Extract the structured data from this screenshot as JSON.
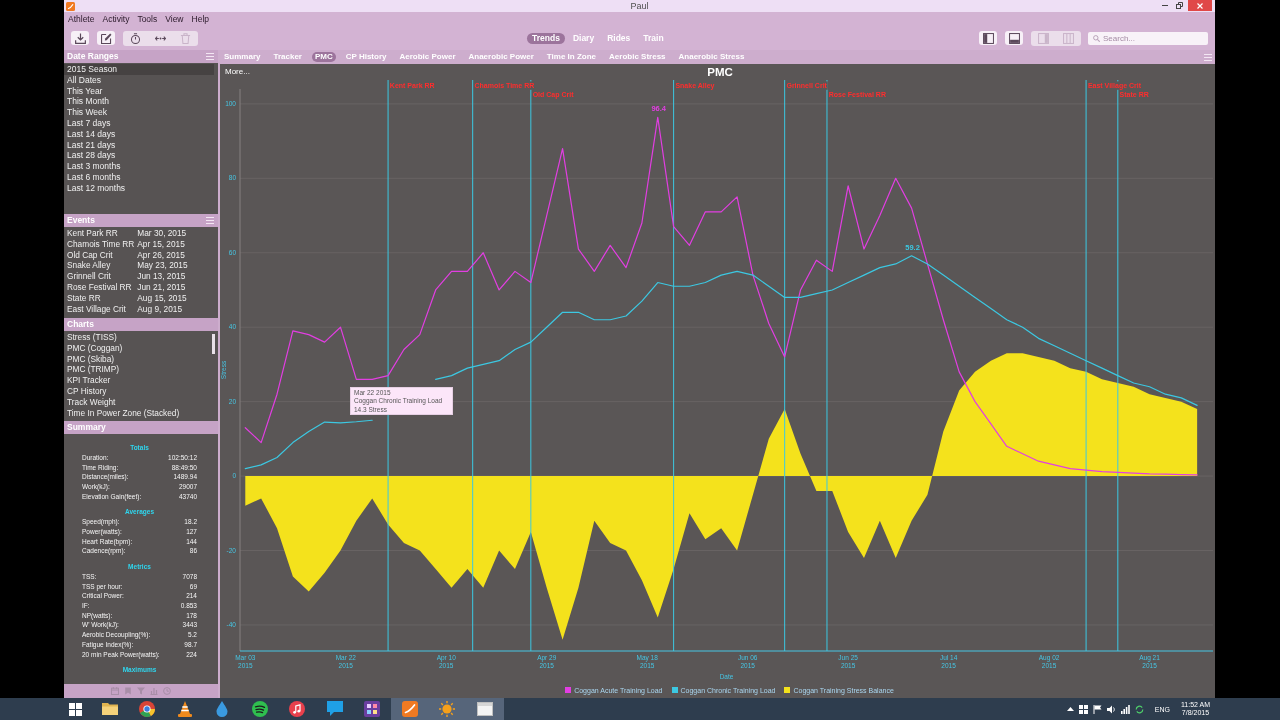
{
  "window": {
    "title": "Paul"
  },
  "menu": [
    "Athlete",
    "Activity",
    "Tools",
    "View",
    "Help"
  ],
  "toolbar": {
    "left_groups": [
      [
        {
          "kind": "download",
          "disabled": false
        }
      ],
      [
        {
          "kind": "edit",
          "disabled": false
        }
      ],
      [
        {
          "kind": "stopwatch",
          "disabled": false
        },
        {
          "kind": "arrows",
          "disabled": false
        },
        {
          "kind": "trash",
          "disabled": true
        }
      ]
    ],
    "views": [
      {
        "label": "Trends",
        "selected": true
      },
      {
        "label": "Diary",
        "selected": false
      },
      {
        "label": "Rides",
        "selected": false
      },
      {
        "label": "Train",
        "selected": false
      }
    ],
    "right_groups": [
      [
        {
          "kind": "leftpanel",
          "disabled": false
        }
      ],
      [
        {
          "kind": "bottompanel",
          "disabled": false
        }
      ],
      [
        {
          "kind": "rightpanel",
          "disabled": true
        },
        {
          "kind": "columns",
          "disabled": true
        }
      ]
    ],
    "search": {
      "placeholder": "Search..."
    }
  },
  "tabs": [
    {
      "label": "Summary",
      "selected": false
    },
    {
      "label": "Tracker",
      "selected": false
    },
    {
      "label": "PMC",
      "selected": true
    },
    {
      "label": "CP History",
      "selected": false
    },
    {
      "label": "Aerobic Power",
      "selected": false
    },
    {
      "label": "Anaerobic Power",
      "selected": false
    },
    {
      "label": "Time In Zone",
      "selected": false
    },
    {
      "label": "Aerobic Stress",
      "selected": false
    },
    {
      "label": "Anaerobic Stress",
      "selected": false
    }
  ],
  "sidebar": {
    "date_ranges": {
      "title": "Date Ranges",
      "items": [
        {
          "label": "2015 Season",
          "selected": true
        },
        {
          "label": "All Dates",
          "selected": false
        },
        {
          "label": "This Year",
          "selected": false
        },
        {
          "label": "This Month",
          "selected": false
        },
        {
          "label": "This Week",
          "selected": false
        },
        {
          "label": "Last 7 days",
          "selected": false
        },
        {
          "label": "Last 14 days",
          "selected": false
        },
        {
          "label": "Last 21 days",
          "selected": false
        },
        {
          "label": "Last 28 days",
          "selected": false
        },
        {
          "label": "Last 3 months",
          "selected": false
        },
        {
          "label": "Last 6 months",
          "selected": false
        },
        {
          "label": "Last 12 months",
          "selected": false
        }
      ]
    },
    "events": {
      "title": "Events",
      "items": [
        {
          "name": "Kent Park RR",
          "date": "Mar 30, 2015"
        },
        {
          "name": "Chamois Time RR",
          "date": "Apr 15, 2015"
        },
        {
          "name": "Old Cap Crit",
          "date": "Apr 26, 2015"
        },
        {
          "name": "Snake Alley",
          "date": "May 23, 2015"
        },
        {
          "name": "Grinnell Crit",
          "date": "Jun 13, 2015"
        },
        {
          "name": "Rose Festival RR",
          "date": "Jun 21, 2015"
        },
        {
          "name": "State RR",
          "date": "Aug 15, 2015"
        },
        {
          "name": "East Village Crit",
          "date": "Aug 9, 2015"
        }
      ]
    },
    "charts": {
      "title": "Charts",
      "items": [
        "Stress (TISS)",
        "PMC (Coggan)",
        "PMC (Skiba)",
        "PMC (TRIMP)",
        "KPI Tracker",
        "CP History",
        "Track Weight",
        "Time In Power Zone (Stacked)"
      ]
    },
    "summary": {
      "title": "Summary",
      "sections": [
        {
          "heading": "Totals",
          "rows": [
            {
              "label": "Duration:",
              "value": "102:50:12"
            },
            {
              "label": "Time Riding:",
              "value": "88:49:50"
            },
            {
              "label": "Distance(miles):",
              "value": "1489.94"
            },
            {
              "label": "Work(kJ):",
              "value": "29007"
            },
            {
              "label": "Elevation Gain(feet):",
              "value": "43740"
            }
          ]
        },
        {
          "heading": "Averages",
          "rows": [
            {
              "label": "Speed(mph):",
              "value": "18.2"
            },
            {
              "label": "Power(watts):",
              "value": "127"
            },
            {
              "label": "Heart Rate(bpm):",
              "value": "144"
            },
            {
              "label": "Cadence(rpm):",
              "value": "86"
            }
          ]
        },
        {
          "heading": "Metrics",
          "rows": [
            {
              "label": "TSS:",
              "value": "7078"
            },
            {
              "label": "TSS per hour:",
              "value": "69"
            },
            {
              "label": "Critical Power:",
              "value": "214"
            },
            {
              "label": "IF:",
              "value": "0.853"
            },
            {
              "label": "NP(watts):",
              "value": "178"
            },
            {
              "label": "W' Work(kJ):",
              "value": "3443"
            },
            {
              "label": "Aerobic Decoupling(%):",
              "value": "5.2"
            },
            {
              "label": "Fatigue Index(%):",
              "value": "98.7"
            },
            {
              "label": "20 min Peak Power(watts):",
              "value": "224"
            }
          ]
        },
        {
          "heading": "Maximums"
        }
      ]
    }
  },
  "pmc": {
    "more_link": "More...",
    "tooltip": [
      "Mar 22 2015",
      "Coggan Chronic Training Load",
      "14.3 Stress"
    ],
    "chart_data": {
      "type": "line",
      "title": "PMC",
      "xlabel": "Date",
      "ylabel": "Stress",
      "x": [
        "2015-03-03",
        "2015-03-06",
        "2015-03-09",
        "2015-03-12",
        "2015-03-15",
        "2015-03-18",
        "2015-03-21",
        "2015-03-24",
        "2015-03-27",
        "2015-03-30",
        "2015-04-02",
        "2015-04-05",
        "2015-04-08",
        "2015-04-11",
        "2015-04-14",
        "2015-04-17",
        "2015-04-20",
        "2015-04-23",
        "2015-04-26",
        "2015-04-29",
        "2015-05-02",
        "2015-05-05",
        "2015-05-08",
        "2015-05-11",
        "2015-05-14",
        "2015-05-17",
        "2015-05-20",
        "2015-05-23",
        "2015-05-26",
        "2015-05-29",
        "2015-06-01",
        "2015-06-04",
        "2015-06-07",
        "2015-06-10",
        "2015-06-13",
        "2015-06-16",
        "2015-06-19",
        "2015-06-22",
        "2015-06-25",
        "2015-06-28",
        "2015-07-01",
        "2015-07-04",
        "2015-07-07",
        "2015-07-10",
        "2015-07-13",
        "2015-07-16",
        "2015-07-19",
        "2015-07-22",
        "2015-07-25",
        "2015-07-28",
        "2015-07-31",
        "2015-08-03",
        "2015-08-06",
        "2015-08-09",
        "2015-08-12",
        "2015-08-15",
        "2015-08-18",
        "2015-08-21",
        "2015-08-24",
        "2015-08-27",
        "2015-08-30"
      ],
      "series": [
        {
          "name": "Coggan Acute Training Load",
          "color": "#e23ee2",
          "values": [
            13,
            9,
            22,
            39,
            38,
            36,
            40,
            26,
            26,
            27,
            34,
            38,
            50,
            55,
            55,
            60,
            50,
            55,
            52,
            70,
            88,
            61,
            55,
            62,
            56,
            68,
            96.4,
            67,
            62,
            71,
            71,
            75,
            54,
            41,
            32,
            50,
            58,
            55,
            78,
            61,
            70,
            80,
            72,
            57,
            42,
            28,
            20,
            14,
            8,
            6,
            4,
            3,
            2,
            1.6,
            1.2,
            1,
            0.8,
            0.6,
            0.5,
            0.4,
            0.3
          ]
        },
        {
          "name": "Coggan Chronic Training Load",
          "color": "#3cc8e2",
          "values": [
            2,
            3,
            5,
            9,
            12,
            14.5,
            14.3,
            14.6,
            15,
            null,
            null,
            null,
            26,
            27,
            29,
            30,
            31,
            34,
            36,
            40,
            44,
            44,
            42,
            42,
            43,
            47,
            52,
            51,
            51,
            52,
            54,
            55,
            54,
            51,
            48,
            48,
            49,
            50,
            52,
            54,
            56,
            57,
            59.2,
            57,
            54,
            51,
            48,
            45,
            42,
            40,
            37,
            35,
            33,
            31,
            29,
            27,
            25,
            24,
            22,
            21,
            19
          ]
        },
        {
          "name": "Coggan Training Stress Balance",
          "color": "#f4e21c",
          "type": "area",
          "values": [
            -8,
            -6,
            -14,
            -27,
            -31,
            -26,
            -20,
            -12,
            -6,
            -13,
            -18,
            -20,
            -25,
            -30,
            -25,
            -30,
            -20,
            -25,
            -15,
            -30,
            -44,
            -30,
            -12,
            -18,
            -20,
            -28,
            -38,
            -25,
            -10,
            -17,
            -14,
            -20,
            -5,
            10,
            18,
            6,
            -4,
            -4,
            -15,
            -22,
            -12,
            -22,
            -12,
            -5,
            12,
            23,
            28,
            31,
            33,
            33,
            32,
            31,
            29,
            28,
            26,
            25,
            24,
            22,
            21,
            20,
            18
          ]
        }
      ],
      "xlim": [
        "2015-03-02",
        "2015-09-02"
      ],
      "ylim": [
        -47,
        104
      ],
      "xticks": [
        {
          "value": "2015-03-03",
          "label": "Mar 03 2015"
        },
        {
          "value": "2015-03-22",
          "label": "Mar 22 2015"
        },
        {
          "value": "2015-04-10",
          "label": "Apr 10 2015"
        },
        {
          "value": "2015-04-29",
          "label": "Apr 29 2015"
        },
        {
          "value": "2015-05-18",
          "label": "May 18 2015"
        },
        {
          "value": "2015-06-06",
          "label": "Jun 06 2015"
        },
        {
          "value": "2015-06-25",
          "label": "Jun 25 2015"
        },
        {
          "value": "2015-07-14",
          "label": "Jul 14 2015"
        },
        {
          "value": "2015-08-02",
          "label": "Aug 02 2015"
        },
        {
          "value": "2015-08-21",
          "label": "Aug 21 2015"
        }
      ],
      "yticks": [
        -40,
        -20,
        0,
        20,
        40,
        60,
        80,
        100
      ],
      "ref_lines": [
        {
          "axis": "x",
          "value": "2015-03-30",
          "label": "Kent Park RR",
          "color": "#3cc8e2"
        },
        {
          "axis": "x",
          "value": "2015-04-15",
          "label": "Chamois Time RR",
          "color": "#3cc8e2"
        },
        {
          "axis": "x",
          "value": "2015-04-26",
          "label": "Old Cap Crit",
          "color": "#3cc8e2"
        },
        {
          "axis": "x",
          "value": "2015-05-23",
          "label": "Snake Alley",
          "color": "#3cc8e2"
        },
        {
          "axis": "x",
          "value": "2015-06-13",
          "label": "Grinnell Crit",
          "color": "#3cc8e2"
        },
        {
          "axis": "x",
          "value": "2015-06-21",
          "label": "Rose Festival RR",
          "color": "#3cc8e2"
        },
        {
          "axis": "x",
          "value": "2015-08-09",
          "label": "East Village Crit",
          "color": "#3cc8e2"
        },
        {
          "axis": "x",
          "value": "2015-08-15",
          "label": "State RR",
          "color": "#3cc8e2"
        }
      ],
      "grid": true,
      "legend": "bottom",
      "annotations": [
        "96.4",
        "59.2"
      ]
    }
  },
  "taskbar": {
    "apps": [
      {
        "kind": "folder",
        "running": false
      },
      {
        "kind": "ring",
        "running": false
      },
      {
        "kind": "cone",
        "running": false
      },
      {
        "kind": "drop",
        "running": false
      },
      {
        "kind": "waves",
        "running": false
      },
      {
        "kind": "note",
        "running": false
      },
      {
        "kind": "bubble",
        "running": false
      },
      {
        "kind": "tile",
        "running": false
      },
      {
        "kind": "swoosh",
        "running": true
      },
      {
        "kind": "sun",
        "running": true
      },
      {
        "kind": "window",
        "running": true
      }
    ],
    "language": "ENG",
    "time": "11:52 AM",
    "date": "7/8/2015"
  }
}
